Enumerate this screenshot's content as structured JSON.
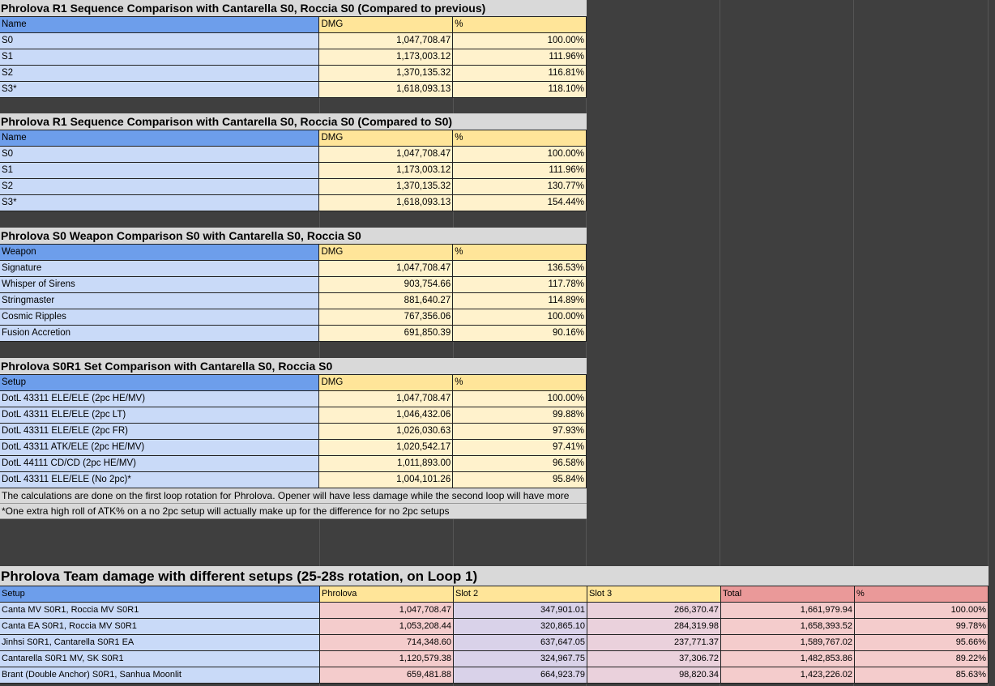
{
  "tables": [
    {
      "title": "Phrolova R1 Sequence Comparison with Cantarella S0, Roccia S0 (Compared to previous)",
      "headers": [
        "Name",
        "DMG",
        "%"
      ],
      "rows": [
        [
          "S0",
          "1,047,708.47",
          "100.00%"
        ],
        [
          "S1",
          "1,173,003.12",
          "111.96%"
        ],
        [
          "S2",
          "1,370,135.32",
          "116.81%"
        ],
        [
          "S3*",
          "1,618,093.13",
          "118.10%"
        ]
      ]
    },
    {
      "title": "Phrolova R1 Sequence Comparison with Cantarella S0, Roccia S0 (Compared to S0)",
      "headers": [
        "Name",
        "DMG",
        "%"
      ],
      "rows": [
        [
          "S0",
          "1,047,708.47",
          "100.00%"
        ],
        [
          "S1",
          "1,173,003.12",
          "111.96%"
        ],
        [
          "S2",
          "1,370,135.32",
          "130.77%"
        ],
        [
          "S3*",
          "1,618,093.13",
          "154.44%"
        ]
      ]
    },
    {
      "title": "Phrolova S0 Weapon Comparison S0 with Cantarella S0, Roccia S0",
      "headers": [
        "Weapon",
        "DMG",
        "%"
      ],
      "rows": [
        [
          "Signature",
          "1,047,708.47",
          "136.53%"
        ],
        [
          "Whisper of Sirens",
          "903,754.66",
          "117.78%"
        ],
        [
          "Stringmaster",
          "881,640.27",
          "114.89%"
        ],
        [
          "Cosmic Ripples",
          "767,356.06",
          "100.00%"
        ],
        [
          "Fusion Accretion",
          "691,850.39",
          "90.16%"
        ]
      ]
    },
    {
      "title": "Phrolova S0R1 Set Comparison with Cantarella S0, Roccia S0",
      "headers": [
        "Setup",
        "DMG",
        "%"
      ],
      "rows": [
        [
          "DotL 43311 ELE/ELE (2pc HE/MV)",
          "1,047,708.47",
          "100.00%"
        ],
        [
          "DotL 43311 ELE/ELE (2pc LT)",
          "1,046,432.06",
          "99.88%"
        ],
        [
          "DotL 43311 ELE/ELE (2pc FR)",
          "1,026,030.63",
          "97.93%"
        ],
        [
          "DotL 43311 ATK/ELE (2pc HE/MV)",
          "1,020,542.17",
          "97.41%"
        ],
        [
          "DotL 44111 CD/CD (2pc HE/MV)",
          "1,011,893.00",
          "96.58%"
        ],
        [
          "DotL 43311 ELE/ELE (No 2pc)*",
          "1,004,101.26",
          "95.84%"
        ]
      ],
      "notes": [
        "The calculations are done on the first loop rotation for Phrolova. Opener will have less damage while the second loop will have more",
        "*One extra high roll of ATK% on a no 2pc setup will actually make up for the difference for no 2pc setups"
      ]
    },
    {
      "title": "Phrolova Team damage with different setups (25-28s rotation, on Loop 1)",
      "headers": [
        "Setup",
        "Phrolova",
        "Slot 2",
        "Slot 3",
        "Total",
        "%"
      ],
      "rows": [
        [
          "Canta MV S0R1, Roccia MV S0R1",
          "1,047,708.47",
          "347,901.01",
          "266,370.47",
          "1,661,979.94",
          "100.00%"
        ],
        [
          "Canta EA S0R1, Roccia MV S0R1",
          "1,053,208.44",
          "320,865.10",
          "284,319.98",
          "1,658,393.52",
          "99.78%"
        ],
        [
          "Jinhsi S0R1, Cantarella S0R1 EA",
          "714,348.60",
          "637,647.05",
          "237,771.37",
          "1,589,767.02",
          "95.66%"
        ],
        [
          "Cantarella S0R1 MV, SK S0R1",
          "1,120,579.38",
          "324,967.75",
          "37,306.72",
          "1,482,853.86",
          "89.22%"
        ],
        [
          "Brant (Double Anchor) S0R1, Sanhua Moonlit",
          "659,481.88",
          "664,923.79",
          "98,820.34",
          "1,423,226.02",
          "85.63%"
        ]
      ]
    }
  ]
}
